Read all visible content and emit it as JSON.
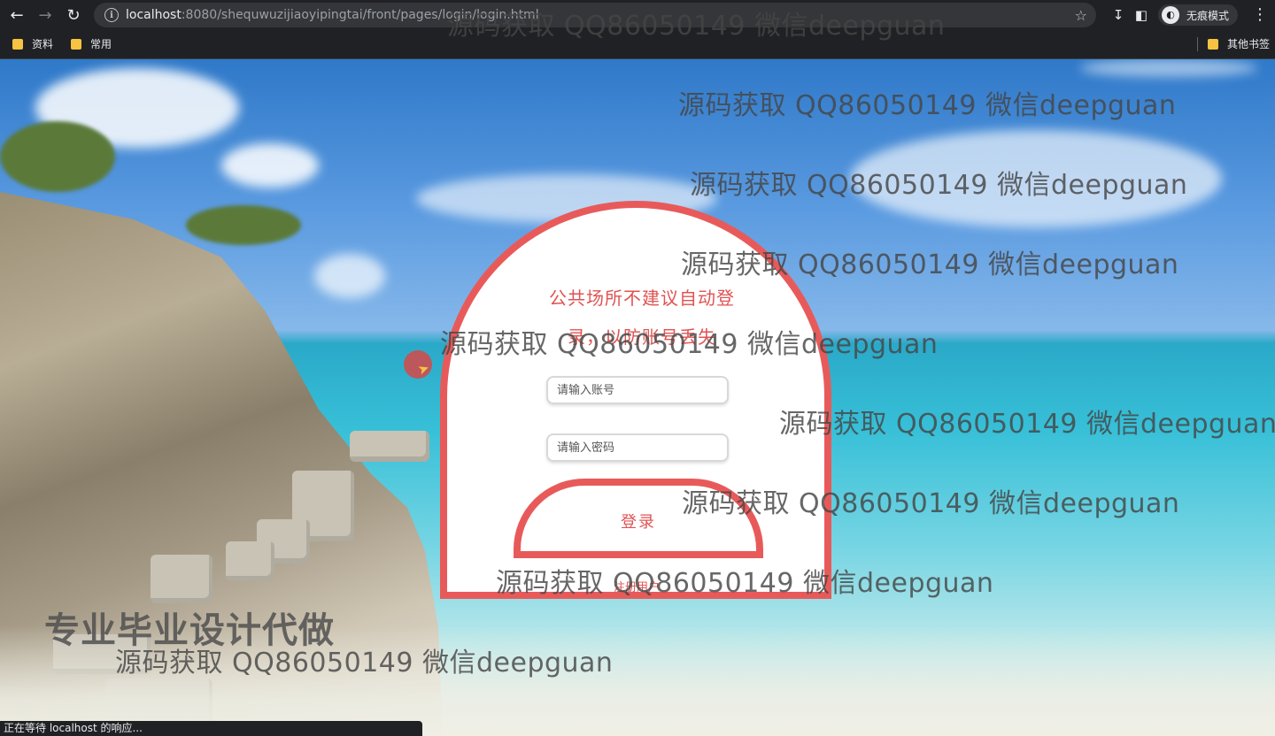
{
  "browser": {
    "url_host": "localhost",
    "url_path": ":8080/shequwuzijiaoyipingtai/front/pages/login/login.html",
    "incognito_label": "无痕模式",
    "bookmarks": [
      {
        "label": "资料"
      },
      {
        "label": "常用"
      }
    ],
    "other_bookmarks_label": "其他书签",
    "status_text": "正在等待 localhost 的响应..."
  },
  "login": {
    "notice_line1": "公共场所不建议自动登",
    "notice_line2": "录，以防账号丢失",
    "username_placeholder": "请输入账号",
    "password_placeholder": "请输入密码",
    "login_label": "登录",
    "register_label": "注册用户"
  },
  "overlay": {
    "watermark_text": "源码获取 QQ86050149 微信deepguan",
    "promo_text": "专业毕业设计代做"
  },
  "colors": {
    "accent": "#e85a5a",
    "chrome_bg": "#202124"
  }
}
